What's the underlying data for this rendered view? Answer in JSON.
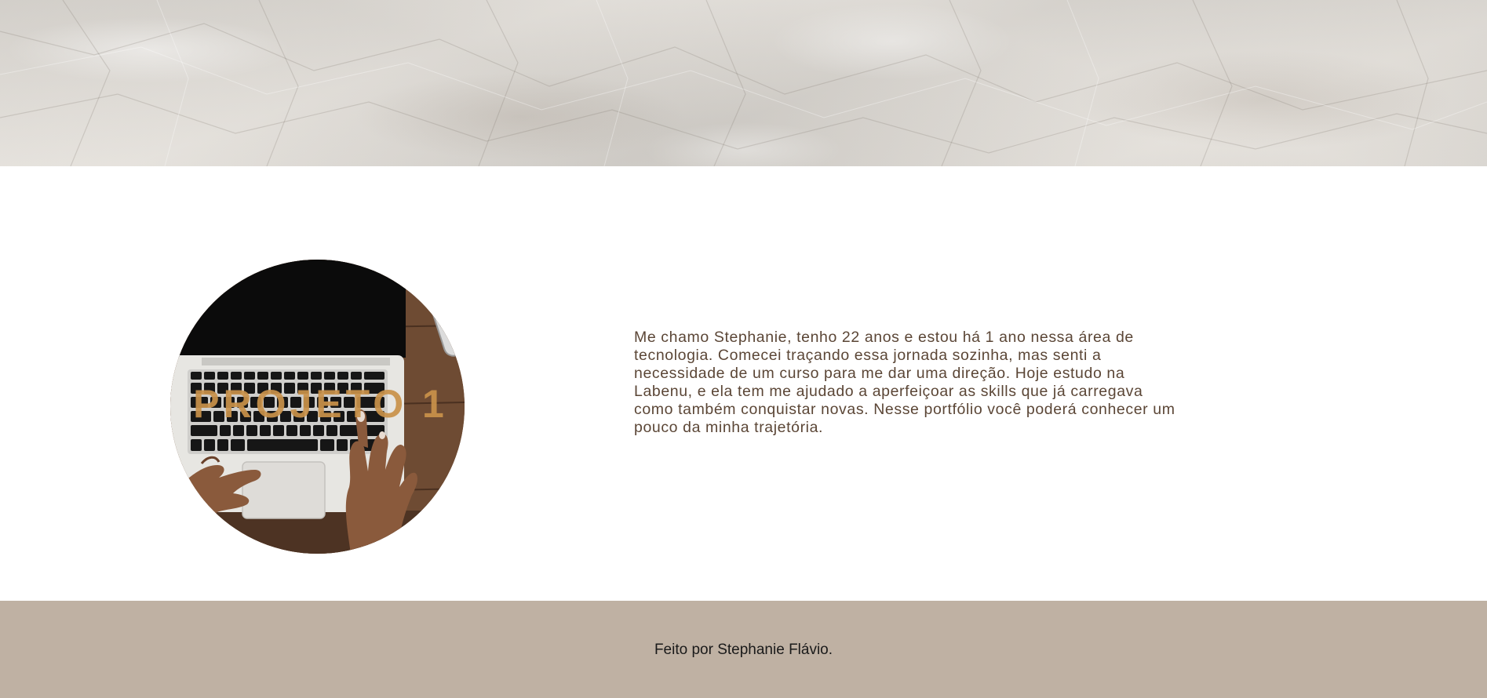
{
  "header": {
    "banner_texture": "crumpled-paper"
  },
  "projects": [
    {
      "title": "PROJETO 1",
      "image": "laptop-hands-photo",
      "title_color": "#c9924a"
    }
  ],
  "about": {
    "text": "Me chamo Stephanie, tenho 22 anos e estou há 1 ano nessa área de tecnologia. Comecei traçando essa jornada sozinha, mas senti a necessidade de um curso para me dar uma direção. Hoje estudo na Labenu, e ela tem me ajudado a aperfeiçoar as skills que já carregava como também conquistar novas. Nesse portfólio você poderá conhecer um pouco da minha trajetória.",
    "text_color": "#5b4636"
  },
  "footer": {
    "text": "Feito por Stephanie Flávio.",
    "background": "#bfb1a3"
  }
}
